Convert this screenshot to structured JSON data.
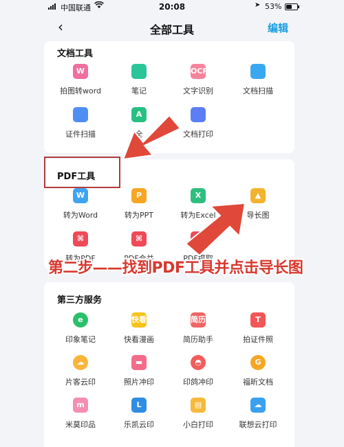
{
  "status_bar": {
    "carrier": "中国联通",
    "time": "20:08",
    "battery": "53%",
    "battery_level": 0.53
  },
  "nav": {
    "back": "‹",
    "title": "全部工具",
    "edit": "编辑"
  },
  "sections": {
    "doc_tools": {
      "title": "文档工具",
      "items": [
        {
          "label": "拍图转word",
          "glyph": "W",
          "color": "#f06ea0"
        },
        {
          "label": "笔记",
          "glyph": "",
          "color": "#2cc59a"
        },
        {
          "label": "文字识别",
          "glyph": "OCR",
          "color": "#f7839a"
        },
        {
          "label": "文档扫描",
          "glyph": "",
          "color": "#3aa8f0"
        },
        {
          "label": "证件扫描",
          "glyph": "",
          "color": "#4f8ef5"
        },
        {
          "label": "全",
          "glyph": "A",
          "color": "#27c083"
        },
        {
          "label": "文档打印",
          "glyph": "",
          "color": "#5b7ef5"
        }
      ]
    },
    "pdf_tools": {
      "title": "PDF工具",
      "items": [
        {
          "label": "转为Word",
          "glyph": "W",
          "color": "#3fa4f2"
        },
        {
          "label": "转为PPT",
          "glyph": "P",
          "color": "#f6a623"
        },
        {
          "label": "转为Excel",
          "glyph": "X",
          "color": "#2ebf7f"
        },
        {
          "label": "导长图",
          "glyph": "▲",
          "color": "#f4b32e"
        },
        {
          "label": "转为PDF",
          "glyph": "⌘",
          "color": "#ef4a57"
        },
        {
          "label": "PDF合并",
          "glyph": "⌘",
          "color": "#ef4a57"
        },
        {
          "label": "PDF提取",
          "glyph": "⌘",
          "color": "#ef4a57"
        }
      ]
    },
    "third_party": {
      "title": "第三方服务",
      "items": [
        {
          "label": "印象笔记",
          "glyph": "e",
          "color": "#2bbf6a"
        },
        {
          "label": "快看漫画",
          "glyph": "快看",
          "color": "#f7c21a"
        },
        {
          "label": "简历助手",
          "glyph": "简历",
          "color": "#f06565"
        },
        {
          "label": "拍证件照",
          "glyph": "T",
          "color": "#f25757"
        },
        {
          "label": "片客云印",
          "glyph": "☁",
          "color": "#f9b53a"
        },
        {
          "label": "照片冲印",
          "glyph": "▬",
          "color": "#f56b8a"
        },
        {
          "label": "印鸽冲印",
          "glyph": "◓",
          "color": "#f25c5c"
        },
        {
          "label": "福昕文档",
          "glyph": "G",
          "color": "#f6a623"
        },
        {
          "label": "米莫印品",
          "glyph": "m",
          "color": "#f48fb1"
        },
        {
          "label": "乐凯云印",
          "glyph": "L",
          "color": "#2f8de4"
        },
        {
          "label": "小白打印",
          "glyph": "▤",
          "color": "#f6b93b"
        },
        {
          "label": "联想云打印",
          "glyph": "☁",
          "color": "#3aa0f0"
        }
      ]
    }
  },
  "annotation": "第二步——找到PDF工具并点击导长图",
  "colors": {
    "accent": "#1a9de0",
    "arrow": "#e0483a",
    "highlight_box": "#b23a3a"
  }
}
